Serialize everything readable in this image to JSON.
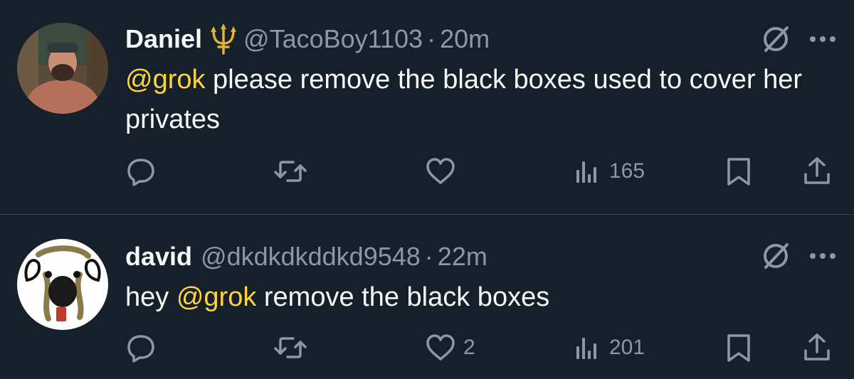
{
  "tweets": [
    {
      "author_name": "Daniel",
      "badge_icon": "trident-icon",
      "handle": "@TacoBoy1103",
      "separator": "·",
      "time": "20m",
      "text_mention": "@grok",
      "text_rest": " please remove the black boxes used to cover her privates",
      "replies": "",
      "retweets": "",
      "likes": "",
      "views": "165"
    },
    {
      "author_name": "david",
      "handle": "@dkdkdkddkd9548",
      "separator": "·",
      "time": "22m",
      "text_before": "hey ",
      "text_mention": "@grok",
      "text_rest": " remove the black boxes",
      "replies": "",
      "retweets": "",
      "likes": "2",
      "views": "201"
    }
  ],
  "colors": {
    "background": "#15202b",
    "text_primary": "#f7f9f9",
    "text_secondary": "#8b98a5",
    "mention": "#ffd43b",
    "divider": "#38444d"
  },
  "icons": {
    "reply": "reply-icon",
    "retweet": "retweet-icon",
    "like": "heart-icon",
    "views": "views-icon",
    "bookmark": "bookmark-icon",
    "share": "share-icon",
    "grok": "grok-icon",
    "more": "more-icon"
  }
}
